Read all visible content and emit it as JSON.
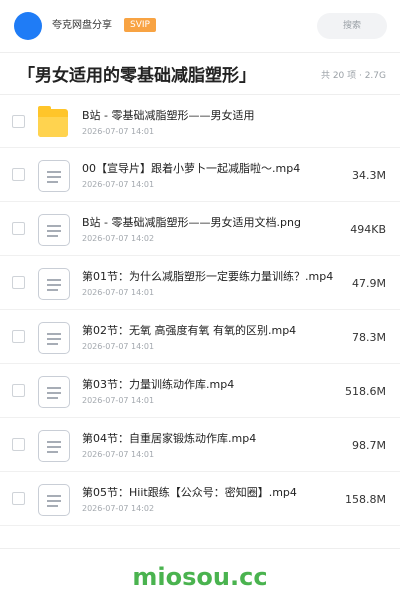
{
  "header": {
    "username": "夸克网盘分享",
    "badge": "SVIP",
    "search_label": "搜索"
  },
  "folder": {
    "title": "「男女适用的零基础减脂塑形」",
    "meta": "共 20 项 · 2.7G"
  },
  "files": [
    {
      "name": "B站 - 零基础减脂塑形——男女适用",
      "date": "2026-07-07 14:01",
      "size": "",
      "icon": "folder-icon"
    },
    {
      "name": "00【宣导片】跟着小萝卜一起减脂啦～.mp4",
      "date": "2026-07-07 14:01",
      "size": "34.3M",
      "icon": "document-icon"
    },
    {
      "name": "B站 - 零基础减脂塑形——男女适用文档.png",
      "date": "2026-07-07 14:02",
      "size": "494KB",
      "icon": "document-icon"
    },
    {
      "name": "第01节：为什么减脂塑形一定要练力量训练？.mp4",
      "date": "2026-07-07 14:01",
      "size": "47.9M",
      "icon": "document-icon"
    },
    {
      "name": "第02节：无氧 高强度有氧 有氧的区别.mp4",
      "date": "2026-07-07 14:01",
      "size": "78.3M",
      "icon": "document-icon"
    },
    {
      "name": "第03节：力量训练动作库.mp4",
      "date": "2026-07-07 14:01",
      "size": "518.6M",
      "icon": "document-icon"
    },
    {
      "name": "第04节：自重居家锻炼动作库.mp4",
      "date": "2026-07-07 14:01",
      "size": "98.7M",
      "icon": "document-icon"
    },
    {
      "name": "第05节：Hiit跟练【公众号：密知圈】.mp4",
      "date": "2026-07-07 14:02",
      "size": "158.8M",
      "icon": "document-icon"
    }
  ],
  "watermark": "miosou.cc",
  "colors": {
    "brand_blue": "#1f7cf6",
    "svip_orange": "#f8a343",
    "folder_yellow": "#ffc52a",
    "watermark_green": "#4ab34f"
  }
}
